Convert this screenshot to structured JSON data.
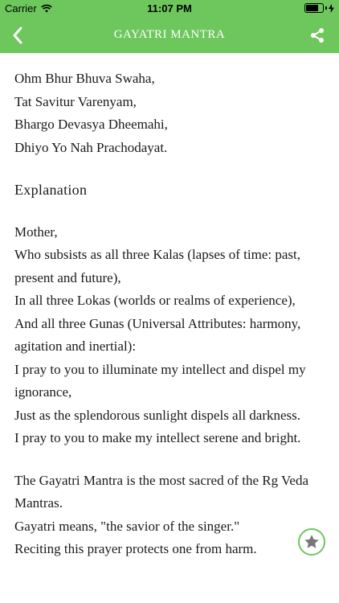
{
  "status_bar": {
    "carrier": "Carrier",
    "time": "11:07 PM"
  },
  "nav": {
    "title": "GAYATRI MANTRA",
    "back_icon": "chevron-left-icon",
    "share_icon": "share-icon"
  },
  "mantra": [
    "Ohm Bhur Bhuva Swaha,",
    "Tat Savitur Varenyam,",
    "Bhargo Devasya Dheemahi,",
    "Dhiyo Yo Nah Prachodayat."
  ],
  "explanation_heading": "Explanation",
  "explanation": [
    "Mother,",
    "Who subsists as all three Kalas (lapses of time: past, present and future),",
    "In all three Lokas (worlds or realms of experience),",
    "And all three Gunas (Universal Attributes: harmony, agitation and inertial):",
    "I pray to you to illuminate my intellect and dispel my ignorance,",
    "Just as the splendorous sunlight dispels all darkness.",
    "I pray to you to make my intellect serene and bright."
  ],
  "description": [
    "The Gayatri Mantra is the most sacred of the Rg Veda Mantras.",
    "Gayatri means, \"the savior of the singer.\"",
    "Reciting this prayer protects one from harm."
  ],
  "fab": {
    "icon": "star-icon"
  },
  "colors": {
    "accent": "#6dc75c",
    "text": "#1a1a1a",
    "background": "#ffffff"
  }
}
